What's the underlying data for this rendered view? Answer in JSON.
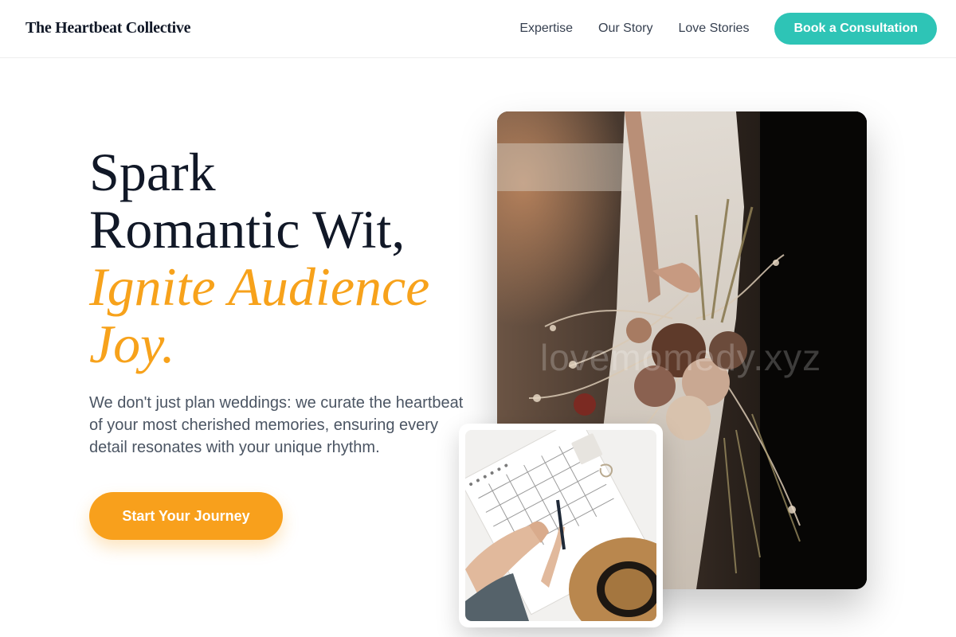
{
  "nav": {
    "brand": "The Heartbeat Collective",
    "links": [
      "Expertise",
      "Our Story",
      "Love Stories"
    ],
    "cta": "Book a Consultation"
  },
  "hero": {
    "headline_line1": "Spark",
    "headline_line2": "Romantic Wit,",
    "headline_accent_line1": "Ignite Audience",
    "headline_accent_line2": "Joy.",
    "description": "We don't just plan weddings: we curate the heartbeat of your most cherished memories, ensuring every detail resonates with your unique rhythm.",
    "cta": "Start Your Journey"
  },
  "images": {
    "main_watermark": "lovemomedy.xyz",
    "main_image_icon": "bride-bouquet-photo",
    "secondary_image_icon": "wedding-planner-notebook-photo"
  },
  "colors": {
    "accent_orange": "#f7a21b",
    "accent_teal": "#2ec4b6",
    "heading_dark": "#111827",
    "body_gray": "#4b5563"
  }
}
